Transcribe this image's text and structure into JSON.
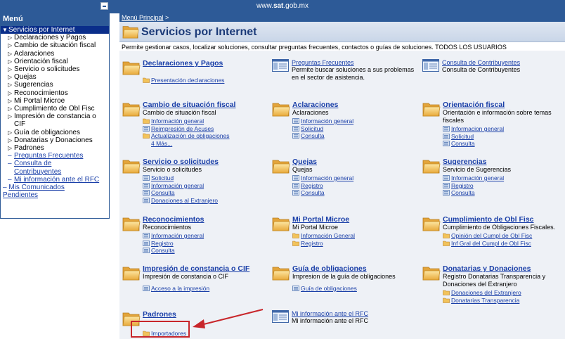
{
  "topbar": {
    "url_prefix": "www.",
    "url_bold": "sat",
    "url_suffix": ".gob.mx"
  },
  "sidebar": {
    "header": "Menú",
    "items": [
      "Servicios por Internet",
      "Declaraciones y Pagos",
      "Cambio de situación fiscal",
      "Aclaraciones",
      "Orientación fiscal",
      "Servicio o solicitudes",
      "Quejas",
      "Sugerencias",
      "Reconocimientos",
      "Mi Portal Microe",
      "Cumplimiento de Obl Fisc",
      "Impresión de constancia o",
      "CIF",
      "Guía de obligaciones",
      "Donatarias y Donaciones",
      "Padrones",
      "Preguntas Frecuentes",
      "Consulta de",
      "Contribuyentes",
      "Mi información ante el RFC",
      "Mis Comunicados",
      "Pendientes"
    ]
  },
  "main": {
    "breadcrumb": "Menú Principal",
    "breadcrumb_sep": ">",
    "title": "Servicios por Internet",
    "description": "Permite gestionar casos, localizar soluciones, consultar preguntas frecuentes, contactos o guías de soluciones. TODOS LOS USUARIOS"
  },
  "cards": {
    "declaraciones": {
      "title": "Declaraciones y Pagos",
      "links": [
        "Presentación declaraciones"
      ]
    },
    "preguntas": {
      "title": "Preguntas Frecuentes",
      "line1": "Permite buscar soluciones a sus problemas",
      "line2": "en el sector de asistencia."
    },
    "consulta": {
      "title": "Consulta de Contribuyentes",
      "sub": "Consulta de Contribuyentes"
    },
    "cambio": {
      "title": "Cambio de situación fiscal",
      "sub": "Cambio de situación fiscal",
      "links": [
        "Información general",
        "Reimpresión de Acuses",
        "Actualización de obligaciones"
      ],
      "more": "4 Más..."
    },
    "aclaraciones": {
      "title": "Aclaraciones",
      "sub": "Aclaraciones",
      "links": [
        "Información general",
        "Solicitud",
        "Consulta"
      ]
    },
    "orientacion": {
      "title": "Orientación fiscal",
      "sub1": "Orientación e información sobre temas",
      "sub2": "fiscales",
      "links": [
        "Informacion general",
        "Solicitud",
        "Consulta"
      ]
    },
    "servicio": {
      "title": "Servicio o solicitudes",
      "sub": "Servicio o solicitudes",
      "links": [
        "Solicitud",
        "Información general",
        "Consulta",
        "Donaciones al Extranjero"
      ]
    },
    "quejas": {
      "title": "Quejas",
      "sub": "Quejas",
      "links": [
        "Información general",
        "Registro",
        "Consulta"
      ]
    },
    "sugerencias": {
      "title": "Sugerencias",
      "sub": "Servicio de Sugerencias",
      "links": [
        "Información general",
        "Registro",
        "Consulta"
      ]
    },
    "reconocimientos": {
      "title": "Reconocimientos",
      "sub": "Reconocimientos",
      "links": [
        "Información general",
        "Registro",
        "Consulta"
      ]
    },
    "microe": {
      "title": "Mi Portal Microe",
      "sub": "Mi Portal Microe",
      "links": [
        "Información General",
        "Registro"
      ]
    },
    "cumplimiento": {
      "title": "Cumplimiento de Obl Fisc",
      "sub": "Cumplimiento de Obligaciones Fiscales.",
      "links": [
        "Opinión del Cumpl de Obl Fisc",
        "Inf Gral del Cumpl de Obl Fisc"
      ]
    },
    "impresion": {
      "title": "Impresión de constancia o CIF",
      "sub": "Impresión de constancia o CIF",
      "links": [
        "Acceso a la impresión"
      ]
    },
    "guia": {
      "title": "Guía de obligaciones",
      "sub": "Impresion de la guía de obligaciones",
      "links": [
        "Guía de obligaciones"
      ]
    },
    "donatarias": {
      "title": "Donatarias y Donaciones",
      "sub1": "Registro Donatarias Transparencia y",
      "sub2": "Donaciones del Extranjero",
      "links": [
        "Donaciones del Extranjero",
        "Donatarias Transparencia"
      ]
    },
    "padrones": {
      "title": "Padrones",
      "links": [
        "Importadores"
      ]
    },
    "mi_info": {
      "title": "Mi información ante el RFC",
      "sub": "Mi información ante el RFC"
    }
  },
  "colors": {
    "brand": "#2d5a97",
    "link": "#1a3fa8",
    "annotation": "#c8262b"
  }
}
